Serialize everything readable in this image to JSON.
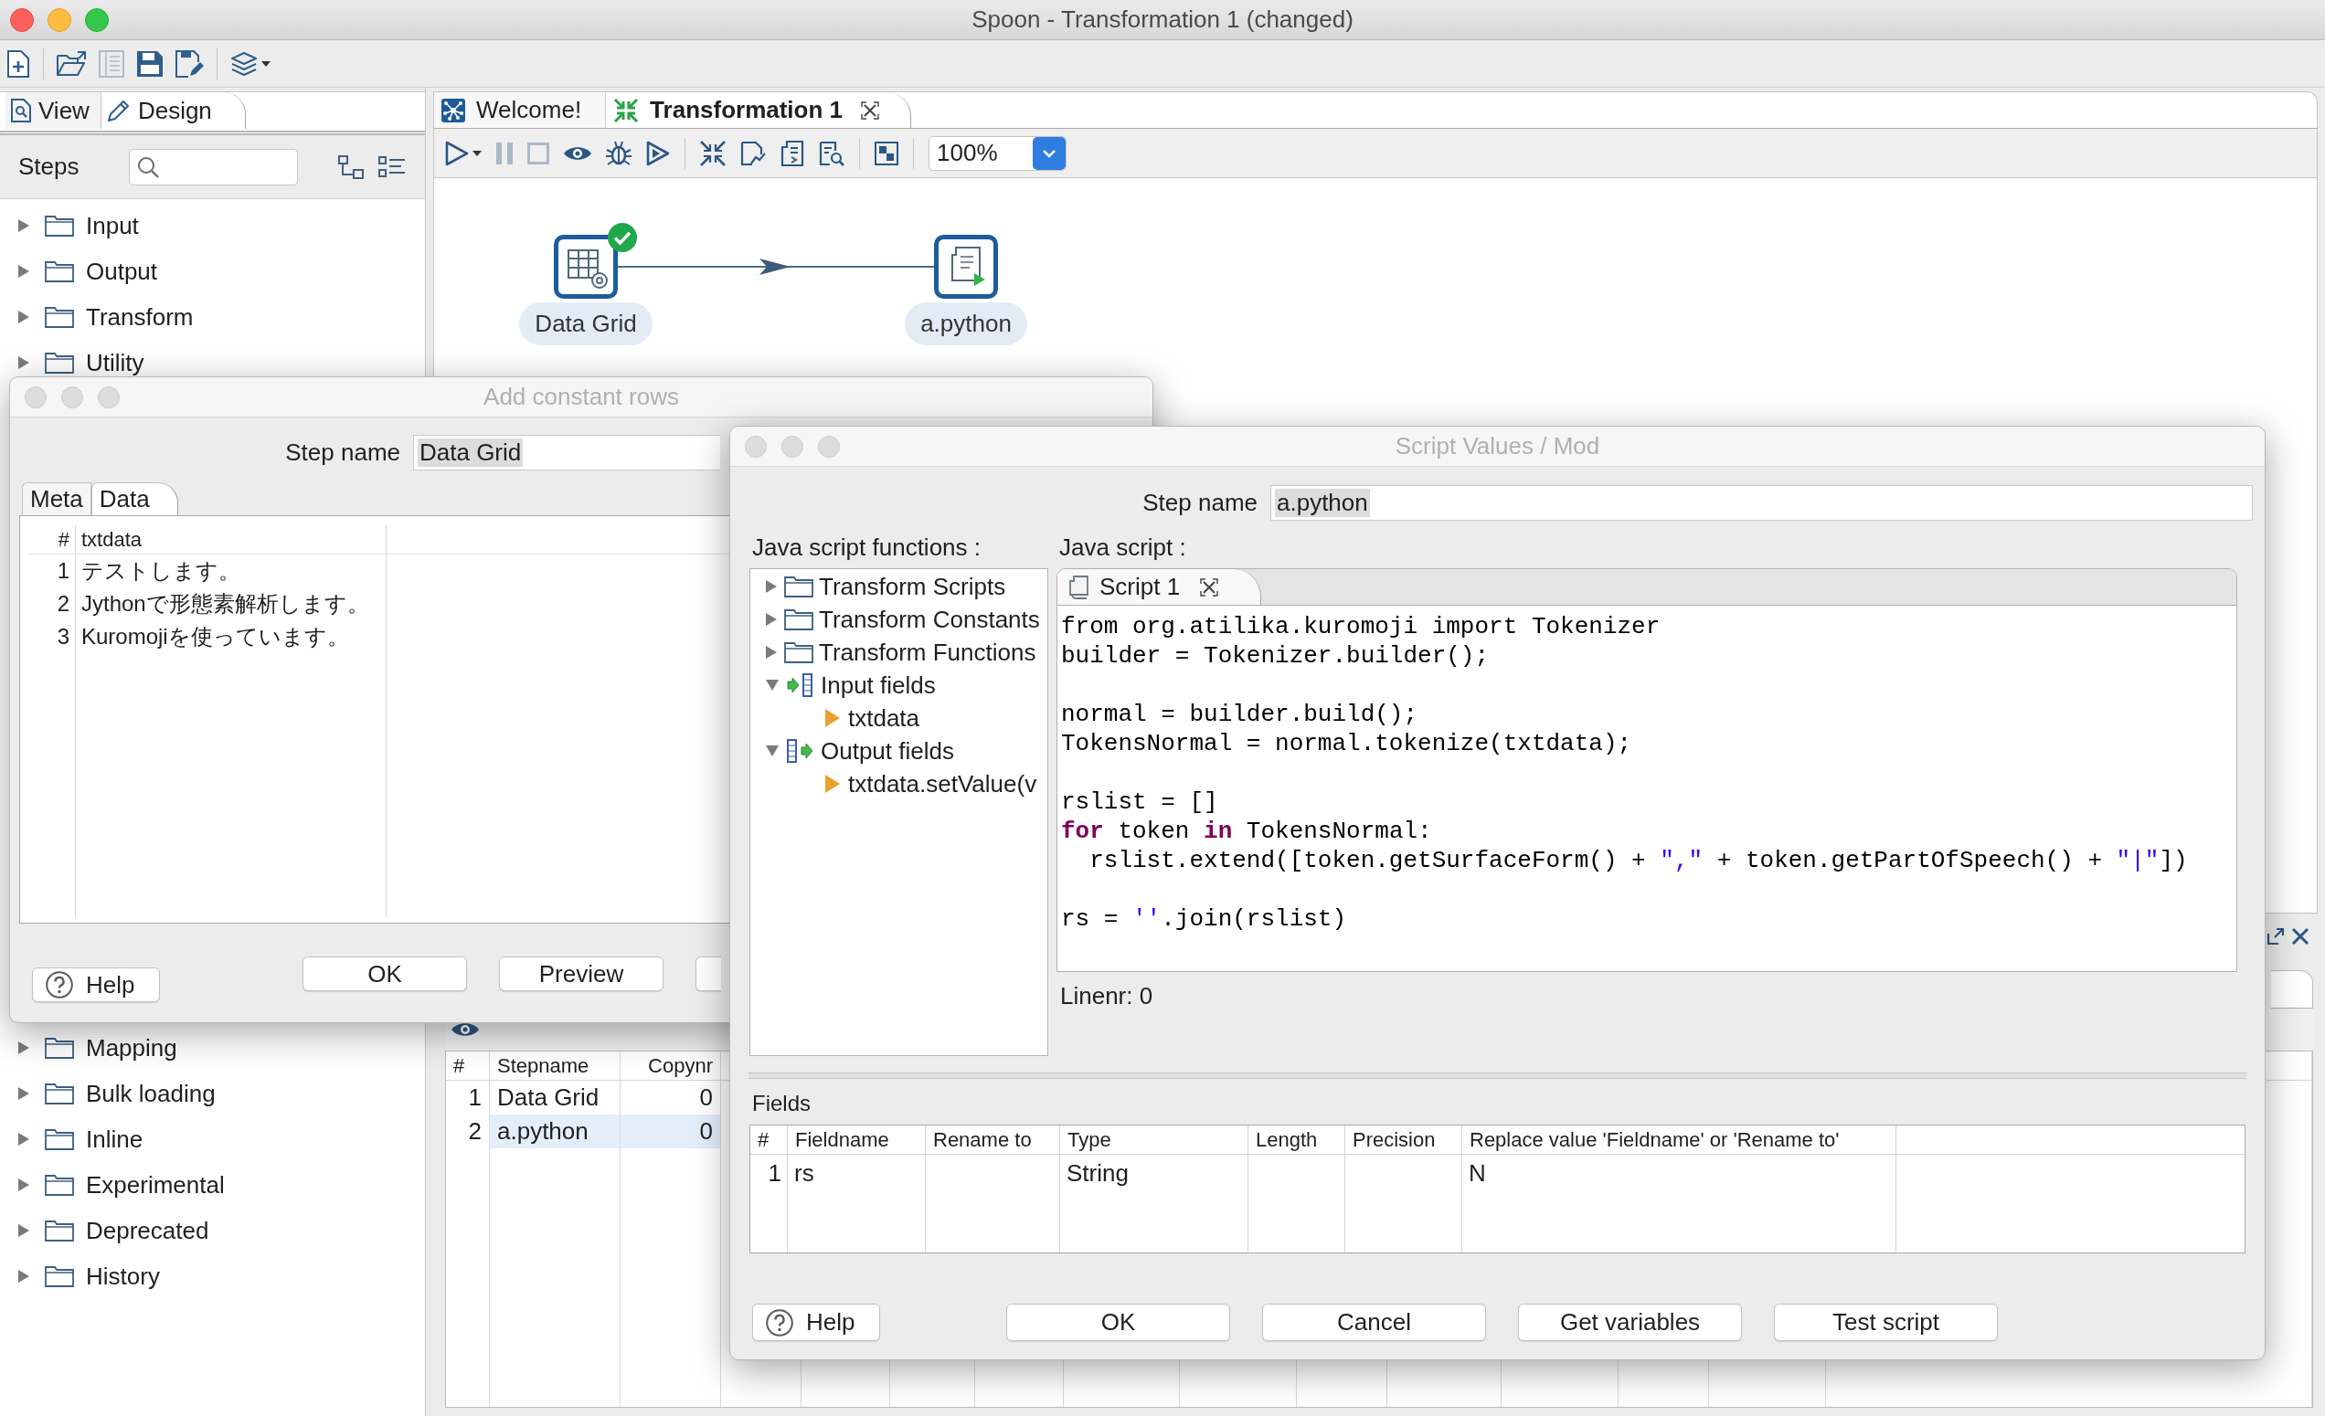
{
  "window": {
    "title": "Spoon - Transformation 1 (changed)",
    "active": true
  },
  "main_toolbar": [
    {
      "disabled": false
    },
    {
      "disabled": false
    },
    {
      "disabled": true
    },
    {
      "disabled": false
    },
    {
      "disabled": false
    },
    {
      "disabled": false
    }
  ],
  "left_panel": {
    "tabs": [
      {
        "label": "View",
        "selected": false
      },
      {
        "label": "Design",
        "selected": true
      }
    ],
    "steps_label": "Steps",
    "steps_tree": [
      {
        "label": "Input",
        "expanded": false
      },
      {
        "label": "Output",
        "expanded": false
      },
      {
        "label": "Transform",
        "expanded": false
      },
      {
        "label": "Utility",
        "expanded": false
      },
      {
        "label": "Mapping",
        "expanded": false
      },
      {
        "label": "Bulk loading",
        "expanded": false
      },
      {
        "label": "Inline",
        "expanded": false
      },
      {
        "label": "Experimental",
        "expanded": false
      },
      {
        "label": "Deprecated",
        "expanded": false
      },
      {
        "label": "History",
        "expanded": false
      }
    ]
  },
  "editor_tabs": [
    {
      "label": "Welcome!",
      "kind": "welcome",
      "selected": false,
      "closable": false
    },
    {
      "label": "Transformation 1",
      "kind": "transformation",
      "selected": true,
      "closable": true
    }
  ],
  "canvas": {
    "toolbar": [
      {
        "disabled": false
      },
      {
        "disabled": true
      },
      {
        "disabled": true
      },
      {
        "disabled": false
      },
      {
        "disabled": false
      },
      {
        "disabled": false
      },
      {
        "disabled": false
      },
      {
        "disabled": false
      },
      {
        "disabled": false
      },
      {
        "disabled": false
      },
      {
        "disabled": false
      }
    ],
    "zoom": "100%",
    "nodes": [
      {
        "label": "Data Grid",
        "kind": "grid",
        "verified": true
      },
      {
        "label": "a.python",
        "kind": "script",
        "verified": false
      }
    ]
  },
  "results": {
    "columns": [
      "#",
      "Stepname",
      "Copynr"
    ],
    "rows": [
      {
        "cells": [
          "1",
          "Data Grid",
          "0"
        ],
        "selected": false
      },
      {
        "cells": [
          "2",
          "a.python",
          "0"
        ],
        "selected": true
      }
    ]
  },
  "add_constant_rows_dialog": {
    "title": "Add constant rows",
    "active": false,
    "step_name_label": "Step name",
    "step_name": "Data Grid",
    "tabs": [
      {
        "label": "Meta",
        "selected": false
      },
      {
        "label": "Data",
        "selected": true
      }
    ],
    "data_table": {
      "columns": [
        "#",
        "txtdata"
      ],
      "rows": [
        [
          "1",
          "テストします。"
        ],
        [
          "2",
          "Jythonで形態素解析します。"
        ],
        [
          "3",
          "Kuromojiを使っています。"
        ]
      ]
    },
    "help_button": "Help",
    "buttons": [
      "OK",
      "Preview"
    ]
  },
  "script_values_dialog": {
    "title": "Script Values / Mod",
    "active": false,
    "step_name_label": "Step name",
    "step_name": "a.python",
    "functions_label": "Java script functions :",
    "functions_tree": [
      {
        "label": "Transform Scripts",
        "kind": "folder",
        "expanded": false
      },
      {
        "label": "Transform Constants",
        "kind": "folder",
        "expanded": false
      },
      {
        "label": "Transform Functions",
        "kind": "folder",
        "expanded": false
      },
      {
        "label": "Input fields",
        "kind": "input",
        "expanded": true,
        "children": [
          {
            "label": "txtdata"
          }
        ]
      },
      {
        "label": "Output fields",
        "kind": "output",
        "expanded": true,
        "children": [
          {
            "label": "txtdata.setValue(v"
          }
        ]
      }
    ],
    "script_label": "Java script :",
    "script_tab": "Script 1",
    "code": [
      {
        "kind": "plain",
        "text": "from org.atilika.kuromoji import Tokenizer\nbuilder = Tokenizer.builder();\n\nnormal = builder.build();\nTokensNormal = normal.tokenize(txtdata);\n\nrslist = []\n"
      },
      {
        "kind": "keyword",
        "text": "for"
      },
      {
        "kind": "plain",
        "text": " token "
      },
      {
        "kind": "keyword",
        "text": "in"
      },
      {
        "kind": "plain",
        "text": " TokensNormal:\n  rslist.extend([token.getSurfaceForm() + "
      },
      {
        "kind": "string",
        "text": "\",\""
      },
      {
        "kind": "plain",
        "text": " + token.getPartOfSpeech() + "
      },
      {
        "kind": "string",
        "text": "\"|\""
      },
      {
        "kind": "plain",
        "text": "])\n\nrs = "
      },
      {
        "kind": "string",
        "text": "''"
      },
      {
        "kind": "plain",
        "text": ".join(rslist)"
      }
    ],
    "line_number": "Linenr: 0",
    "fields_label": "Fields",
    "fields_table": {
      "columns": [
        "#",
        "Fieldname",
        "Rename to",
        "Type",
        "Length",
        "Precision",
        "Replace value 'Fieldname' or 'Rename to'"
      ],
      "rows": [
        {
          "number": "1",
          "fieldname": "rs",
          "type": "String",
          "replace_value": "N"
        }
      ]
    },
    "help_button": "Help",
    "buttons": [
      "OK",
      "Cancel",
      "Get variables",
      "Test script"
    ]
  }
}
